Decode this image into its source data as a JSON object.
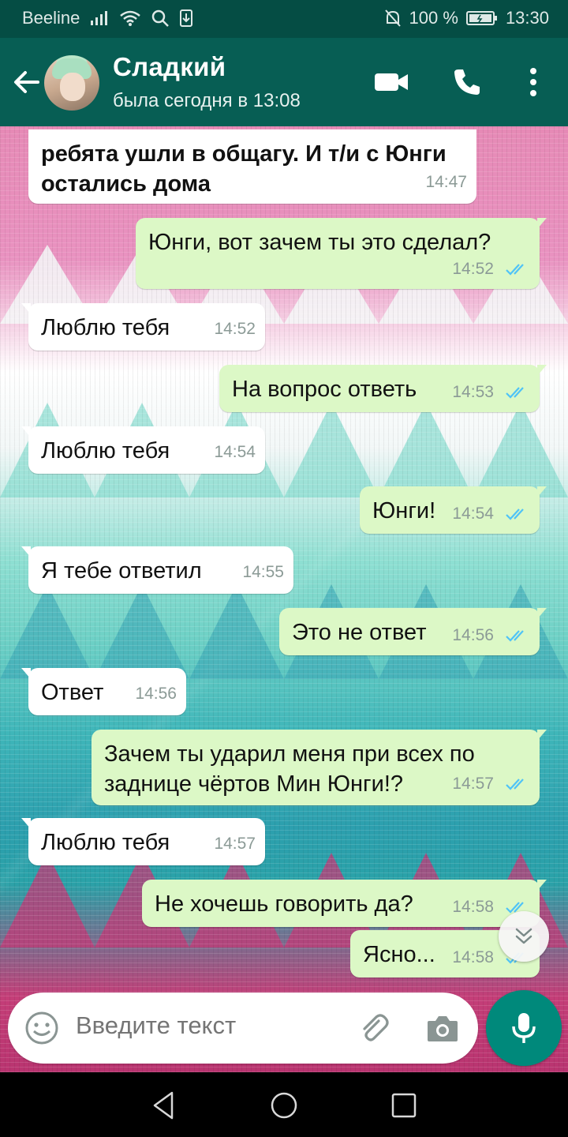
{
  "status_bar": {
    "carrier": "Beeline",
    "battery": "100 %",
    "time": "13:30",
    "icons": [
      "signal-icon",
      "wifi-icon",
      "search-icon",
      "download-icon",
      "mute-icon",
      "battery-icon"
    ]
  },
  "header": {
    "name": "Сладкий",
    "status": "была сегодня в 13:08",
    "icons": [
      "back-arrow-icon",
      "avatar",
      "video-call-icon",
      "phone-icon",
      "more-icon"
    ]
  },
  "messages": [
    {
      "dir": "in",
      "text": "ребята ушли в общагу. И т/и с Юнги остались дома",
      "time": "14:47",
      "bold": true
    },
    {
      "dir": "out",
      "text": "Юнги, вот зачем ты это сделал?",
      "time": "14:52"
    },
    {
      "dir": "in",
      "text": "Люблю тебя",
      "time": "14:52"
    },
    {
      "dir": "out",
      "text": "На вопрос ответь",
      "time": "14:53"
    },
    {
      "dir": "in",
      "text": "Люблю тебя",
      "time": "14:54"
    },
    {
      "dir": "out",
      "text": "Юнги!",
      "time": "14:54"
    },
    {
      "dir": "in",
      "text": "Я тебе ответил",
      "time": "14:55"
    },
    {
      "dir": "out",
      "text": "Это не ответ",
      "time": "14:56"
    },
    {
      "dir": "in",
      "text": "Ответ",
      "time": "14:56"
    },
    {
      "dir": "out",
      "text": "Зачем ты ударил меня при всех по заднице чёртов Мин Юнги!?",
      "time": "14:57"
    },
    {
      "dir": "in",
      "text": "Люблю тебя",
      "time": "14:57"
    },
    {
      "dir": "out",
      "text": "Не хочешь говорить да?",
      "time": "14:58"
    },
    {
      "dir": "out",
      "text": "Ясно...",
      "time": "14:58"
    }
  ],
  "input": {
    "placeholder": "Введите текст"
  },
  "colors": {
    "header": "#075e54",
    "status_bar": "#054d44",
    "outgoing_bubble": "#dcf8c6",
    "incoming_bubble": "#ffffff",
    "read_ticks": "#4fc3f7",
    "mic_button": "#00897b"
  }
}
